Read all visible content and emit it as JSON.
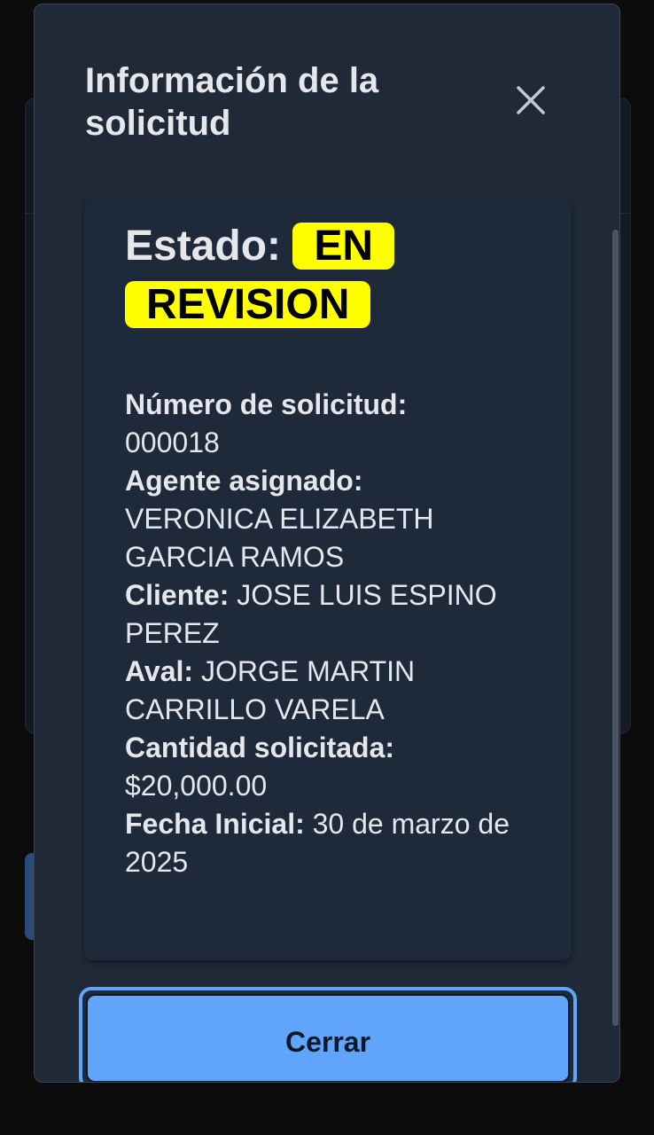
{
  "modal": {
    "title": "Información de la solicitud",
    "close_icon": "close-icon"
  },
  "status": {
    "label": "Estado:",
    "value": "EN REVISION",
    "badge_color": "#ffff00"
  },
  "details": {
    "request_number_label": "Número de solicitud:",
    "request_number_value": "000018",
    "agent_label": "Agente asignado:",
    "agent_value": "VERONICA ELIZABETH GARCIA RAMOS",
    "client_label": "Cliente:",
    "client_value": "JOSE LUIS ESPINO PEREZ",
    "guarantor_label": "Aval:",
    "guarantor_value": "JORGE MARTIN CARRILLO VARELA",
    "amount_label": "Cantidad solicitada:",
    "amount_value": "$20,000.00",
    "start_date_label": "Fecha Inicial:",
    "start_date_value": "30 de marzo de 2025"
  },
  "actions": {
    "close_label": "Cerrar",
    "accent_color": "#60a5fa"
  }
}
